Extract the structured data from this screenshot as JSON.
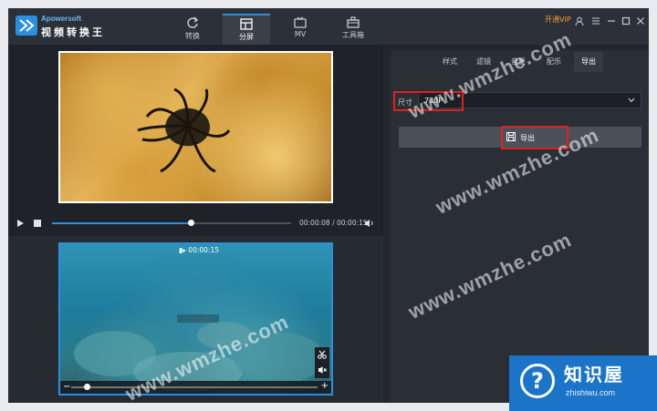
{
  "app": {
    "brand": "Apowersoft",
    "title": "视频转换王"
  },
  "tabs": [
    {
      "label": "转换"
    },
    {
      "label": "分屏"
    },
    {
      "label": "MV"
    },
    {
      "label": "工具箱"
    }
  ],
  "window_controls": {
    "vip_label": "开通VIP"
  },
  "player": {
    "time_display": "00:00:08 / 00:00:15",
    "progress": 0.58
  },
  "split_preview": {
    "duration": "00:00:15",
    "seek_fraction": 0.05
  },
  "right_panel": {
    "tabs": [
      {
        "label": "样式"
      },
      {
        "label": "滤镜"
      },
      {
        "label": "音量"
      },
      {
        "label": "配乐"
      },
      {
        "label": "导出"
      }
    ],
    "size_label": "尺寸",
    "size_value": "720P",
    "export_label": "导出"
  },
  "watermark": {
    "text": "www.wmzhe.com"
  },
  "badge": {
    "name": "知识屋",
    "url": "zhishiwu.com"
  },
  "colors": {
    "accent": "#2b8fe0",
    "highlight": "#e02020",
    "vip": "#f0a030"
  }
}
